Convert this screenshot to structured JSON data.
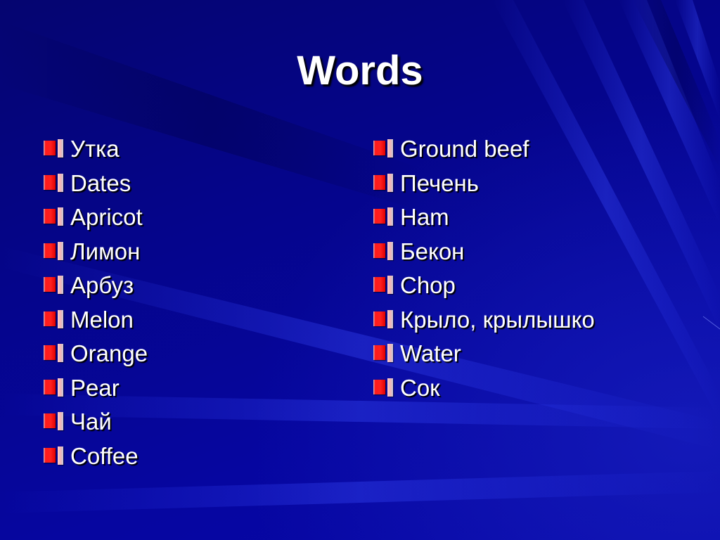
{
  "slide": {
    "title": "Words",
    "colors": {
      "background": "#0606a0",
      "text": "#ffffff",
      "bullet_red": "#ff2020",
      "bullet_pink": "#f3b4b4"
    },
    "bullet_icon": "red-pink-double-bar-bullet",
    "left_column": [
      "Утка",
      "Dates",
      "Apricot",
      "Лимон",
      "Арбуз",
      "Melon",
      "Orange",
      "Pear",
      "Чай",
      "Coffee"
    ],
    "right_column": [
      "Ground beef",
      "Печень",
      "Ham",
      "Бекон",
      "Chop",
      "Крыло, крылышко",
      "Water",
      "Сок"
    ]
  }
}
